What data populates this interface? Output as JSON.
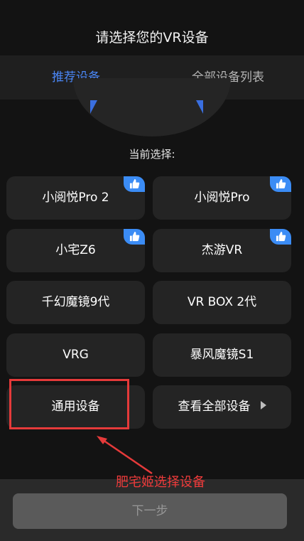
{
  "header": {
    "title": "请选择您的VR设备"
  },
  "tabs": [
    {
      "label": "推荐设备",
      "active": true
    },
    {
      "label": "全部设备列表",
      "active": false
    }
  ],
  "current_selection_label": "当前选择:",
  "devices": [
    {
      "label": "小阅悦Pro 2",
      "recommended": true
    },
    {
      "label": "小阅悦Pro",
      "recommended": true
    },
    {
      "label": "小宅Z6",
      "recommended": true
    },
    {
      "label": "杰游VR",
      "recommended": true
    },
    {
      "label": "千幻魔镜9代",
      "recommended": false
    },
    {
      "label": "VR BOX 2代",
      "recommended": false
    },
    {
      "label": "VRG",
      "recommended": false
    },
    {
      "label": "暴风魔镜S1",
      "recommended": false
    },
    {
      "label": "通用设备",
      "recommended": false
    }
  ],
  "view_all": {
    "label": "查看全部设备"
  },
  "annotation": {
    "text": "肥宅姬选择设备"
  },
  "footer": {
    "next_label": "下一步",
    "enabled": false
  },
  "colors": {
    "accent": "#4a86f5",
    "badge": "#3b8cf5",
    "annotation": "#e53a3a",
    "background": "#131313",
    "button": "#242424"
  },
  "icons": [
    "thumbs-up-icon",
    "arrow-right-icon",
    "red-arrow-icon"
  ]
}
